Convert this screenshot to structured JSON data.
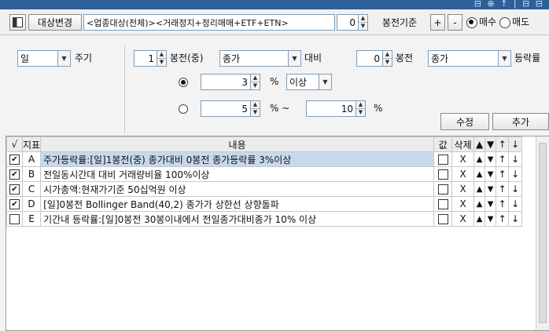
{
  "titlebar": {
    "controls": "⊟ ⊕ ↑ | ⊟ ⊟"
  },
  "toolbar": {
    "target_change": "대상변경",
    "universe": "<업종대상(전체)><거래정지+정리매매+ETF+ETN>",
    "bar_offset": "0",
    "bar_basis": "봉전기준",
    "plus": "+",
    "minus": "-",
    "buy": "매수",
    "sell": "매도"
  },
  "condition": {
    "period_value": "일",
    "period_label": "주기",
    "bar_count": "1",
    "bar_label": "봉전(중)",
    "price_type": "종가",
    "compare_label": "대비",
    "compare_count": "0",
    "compare_bar_label": "봉전",
    "compare_price": "종가",
    "rate_label": "등락률",
    "option1_value": "3",
    "option1_unit": "%",
    "option1_cond": "이상",
    "option2_from": "5",
    "option2_unit": "% ~",
    "option2_to": "10",
    "option2_to_unit": "%",
    "edit_button": "수정",
    "add_button": "추가"
  },
  "grid": {
    "headers": {
      "check": "√",
      "indicator": "지표",
      "content": "내용",
      "value": "값",
      "delete": "삭제",
      "up_tri": "▲",
      "down_tri": "▼",
      "up": "↑",
      "down": "↓"
    },
    "rows": [
      {
        "checked": true,
        "id": "A",
        "content": "주가등락률:[일]1봉전(중) 종가대비 0봉전 종가등락률 3%이상",
        "delete": "X",
        "up_tri": "▲",
        "down_tri": "▼",
        "up": "↑",
        "down": "↓"
      },
      {
        "checked": true,
        "id": "B",
        "content": "전일동시간대 대비 거래량비율 100%이상",
        "delete": "X",
        "up_tri": "▲",
        "down_tri": "▼",
        "up": "↑",
        "down": "↓"
      },
      {
        "checked": true,
        "id": "C",
        "content": "시가총액:현재가기준 50십억원 이상",
        "delete": "X",
        "up_tri": "▲",
        "down_tri": "▼",
        "up": "↑",
        "down": "↓"
      },
      {
        "checked": true,
        "id": "D",
        "content": "[일]0봉전 Bollinger Band(40,2) 종가가 상한선 상향돌파",
        "delete": "X",
        "up_tri": "▲",
        "down_tri": "▼",
        "up": "↑",
        "down": "↓"
      },
      {
        "checked": false,
        "id": "E",
        "content": "기간내 등락률:[일]0봉전 30봉이내에서 전일종가대비종가 10% 이상",
        "delete": "X",
        "up_tri": "▲",
        "down_tri": "▼",
        "up": "↑",
        "down": "↓"
      }
    ]
  }
}
